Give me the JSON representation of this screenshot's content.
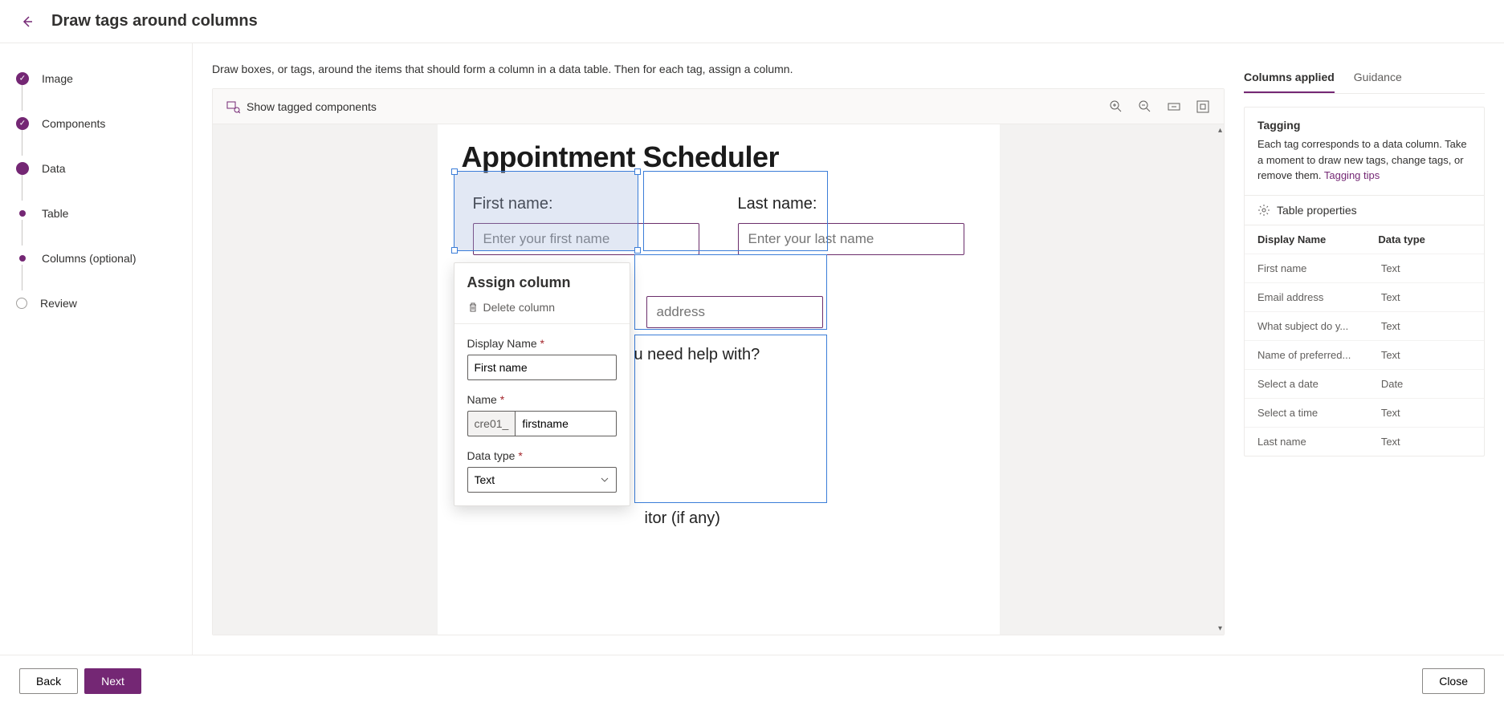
{
  "header": {
    "title": "Draw tags around columns"
  },
  "sidebar": {
    "steps": [
      {
        "label": "Image"
      },
      {
        "label": "Components"
      },
      {
        "label": "Data"
      },
      {
        "label": "Table"
      },
      {
        "label": "Columns (optional)"
      },
      {
        "label": "Review"
      }
    ]
  },
  "instruction": "Draw boxes, or tags, around the items that should form a column in a data table. Then for each tag, assign a column.",
  "toolbar": {
    "show_tagged": "Show tagged components"
  },
  "form": {
    "title": "Appointment Scheduler",
    "first_name_label": "First name:",
    "first_name_placeholder": "Enter your first name",
    "last_name_label": "Last name:",
    "last_name_placeholder": "Enter your last name",
    "email_placeholder": "address",
    "subject_partial": "u need help with?",
    "tutor_partial": "itor (if any)"
  },
  "popover": {
    "title": "Assign column",
    "delete": "Delete column",
    "display_name_label": "Display Name",
    "display_name_value": "First name",
    "name_label": "Name",
    "name_prefix": "cre01_",
    "name_value": "firstname",
    "datatype_label": "Data type",
    "datatype_value": "Text"
  },
  "right": {
    "tabs": {
      "columns": "Columns applied",
      "guidance": "Guidance"
    },
    "info_title": "Tagging",
    "info_text": "Each tag corresponds to a data column. Take a moment to draw new tags, change tags, or remove them. ",
    "info_link": "Tagging tips",
    "table_props": "Table properties",
    "headers": {
      "name": "Display Name",
      "type": "Data type"
    },
    "rows": [
      {
        "name": "First name",
        "type": "Text"
      },
      {
        "name": "Email address",
        "type": "Text"
      },
      {
        "name": "What subject do y...",
        "type": "Text"
      },
      {
        "name": "Name of preferred...",
        "type": "Text"
      },
      {
        "name": "Select a date",
        "type": "Date"
      },
      {
        "name": "Select a time",
        "type": "Text"
      },
      {
        "name": "Last name",
        "type": "Text"
      }
    ]
  },
  "footer": {
    "back": "Back",
    "next": "Next",
    "close": "Close"
  }
}
